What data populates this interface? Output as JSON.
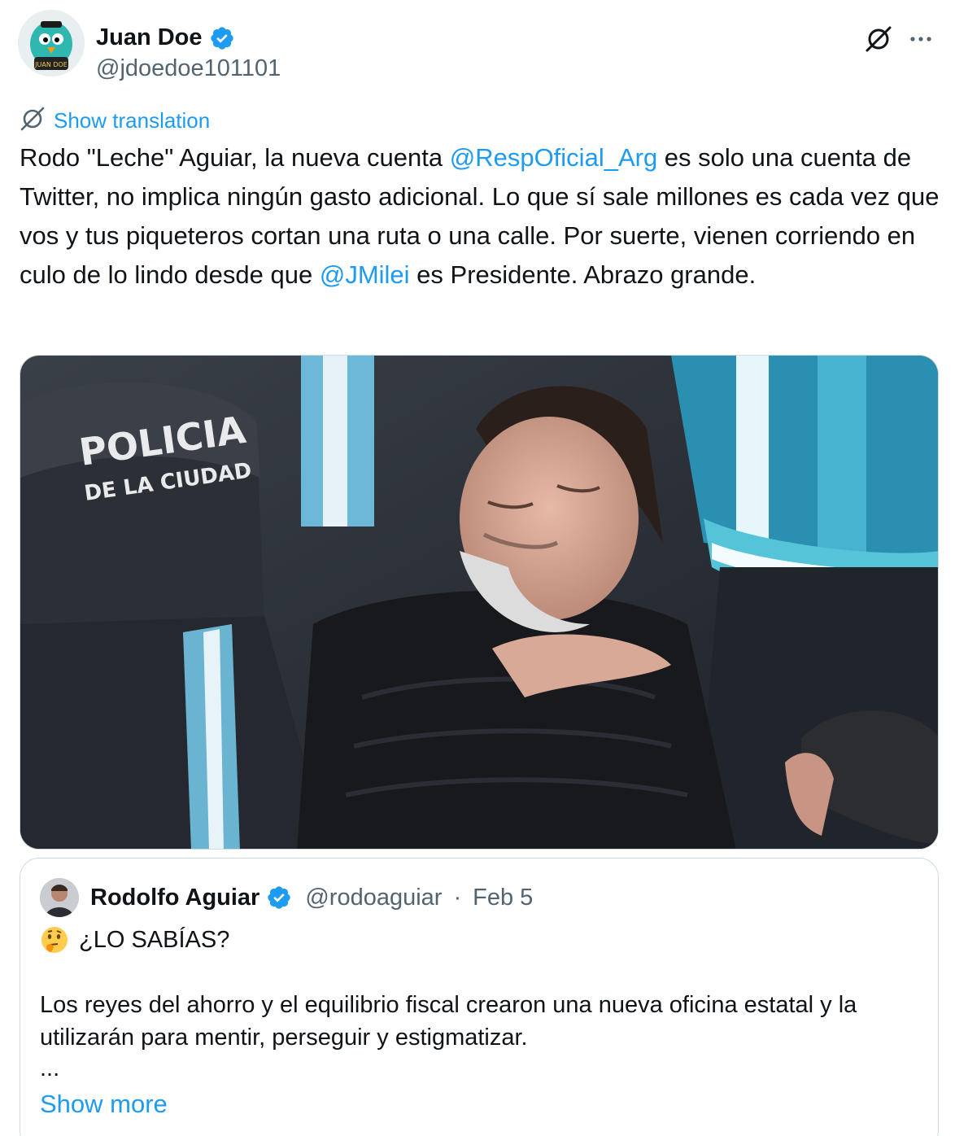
{
  "author": {
    "display_name": "Juan Doe",
    "handle": "@jdoedoe101101",
    "avatar_text": "JUAN DOE"
  },
  "translate_label": "Show translation",
  "tweet": {
    "p1": "Rodo \"Leche\" Aguiar, la nueva cuenta ",
    "mention1": "@RespOficial_Arg",
    "p2": " es solo una cuenta de Twitter, no implica ningún gasto adicional. Lo que sí sale millones es cada vez que vos y tus piqueteros cortan una ruta o una calle. Por suerte, vienen corriendo en culo de lo lindo desde que ",
    "mention2": "@JMilei",
    "p3": " es Presidente. Abrazo grande."
  },
  "media": {
    "helmet_line1": "POLICIA",
    "helmet_line2": "DE LA CIUDAD"
  },
  "quote": {
    "display_name": "Rodolfo Aguiar",
    "handle": "@rodoaguiar",
    "separator": "·",
    "date": "Feb 5",
    "line1": "¿LO SABÍAS?",
    "body": "Los reyes del ahorro y el equilibrio fiscal crearon una nueva oficina estatal y la utilizarán para mentir,  perseguir y estigmatizar.",
    "ellipsis": "...",
    "show_more": "Show more"
  },
  "colors": {
    "accent": "#1d9bf0",
    "text": "#0f1419",
    "secondary": "#536471",
    "border": "#cfd9de"
  }
}
